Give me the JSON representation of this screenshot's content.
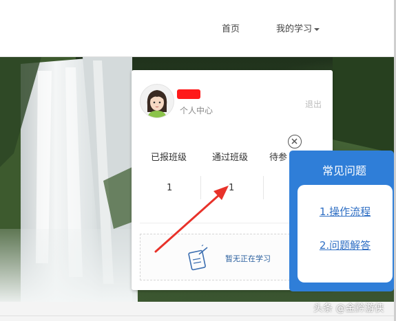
{
  "nav": {
    "home": "首页",
    "my_study": "我的学习"
  },
  "user": {
    "center_link": "个人中心",
    "logout": "退出"
  },
  "stats": [
    {
      "label": "已报班级",
      "value": "1"
    },
    {
      "label": "通过班级",
      "value": "1"
    },
    {
      "label": "待参",
      "value": ""
    }
  ],
  "empty_state": "暂无正在学习",
  "faq": {
    "title": "常见问题",
    "items": [
      "1.操作流程",
      "2.问题解答"
    ]
  },
  "watermark": "头条 @金黔游侠",
  "colors": {
    "faq_panel": "#2f7ed8",
    "faq_link": "#2f6fc4",
    "annotation_arrow": "#e8322a",
    "username_redaction": "#ff1a1a"
  },
  "icons": [
    "caret-down-icon",
    "close-icon",
    "avatar",
    "empty-learning-icon",
    "annotation-arrow"
  ]
}
